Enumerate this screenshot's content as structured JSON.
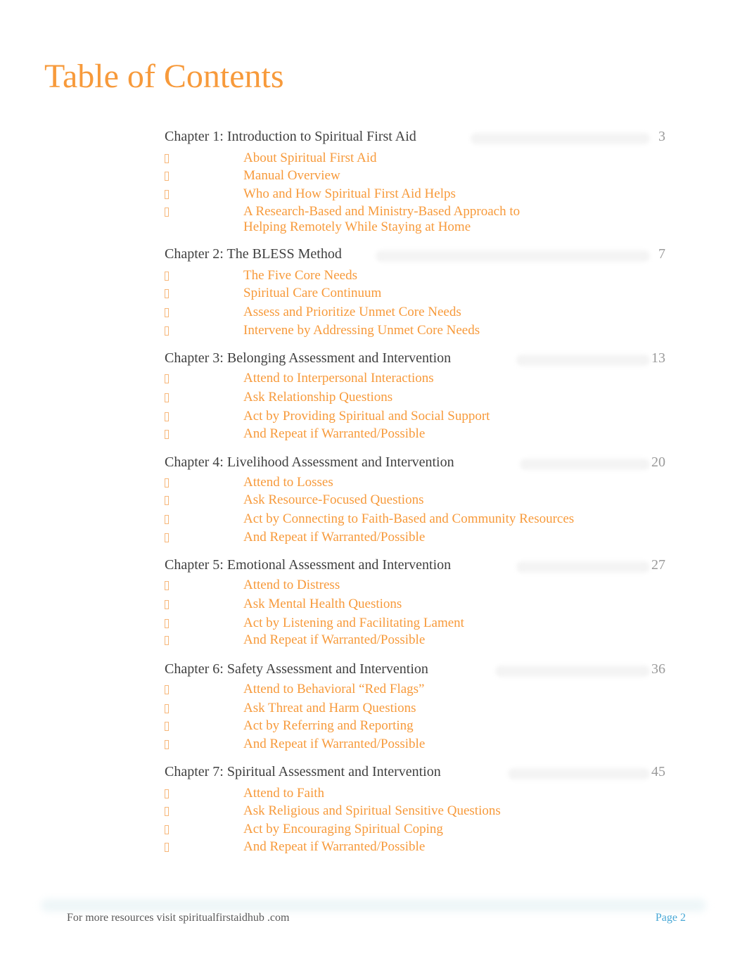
{
  "page_title": "Table of Contents",
  "chapters": [
    {
      "title": "Chapter 1: Introduction to Spiritual First Aid",
      "page": "3",
      "sections": [
        "About Spiritual First Aid",
        "Manual Overview",
        "Who and How Spiritual First Aid Helps",
        "A Research-Based and Ministry-Based Approach to Helping Remotely While Staying at Home"
      ]
    },
    {
      "title": "Chapter 2: The BLESS Method",
      "page": "7",
      "sections": [
        "The Five Core Needs",
        "Spiritual Care Continuum",
        "Assess and Prioritize Unmet Core Needs",
        "Intervene by Addressing Unmet Core Needs"
      ]
    },
    {
      "title": "Chapter 3: Belonging Assessment and Intervention",
      "page": "13",
      "sections": [
        "Attend to Interpersonal Interactions",
        "Ask Relationship Questions",
        "Act by Providing Spiritual and Social Support",
        "And Repeat if Warranted/Possible"
      ]
    },
    {
      "title": "Chapter 4: Livelihood Assessment and Intervention",
      "page": "20",
      "sections": [
        "Attend to Losses",
        "Ask Resource-Focused Questions",
        "Act by Connecting to Faith-Based and Community Resources",
        "And Repeat if Warranted/Possible"
      ]
    },
    {
      "title": "Chapter 5: Emotional Assessment and Intervention",
      "page": "27",
      "sections": [
        "Attend to Distress",
        "Ask Mental Health Questions",
        "Act by Listening and Facilitating Lament",
        "And Repeat if Warranted/Possible"
      ]
    },
    {
      "title": "Chapter 6: Safety Assessment and Intervention",
      "page": "36",
      "sections": [
        "Attend to Behavioral “Red Flags”",
        "Ask Threat and Harm Questions",
        "Act by Referring and Reporting",
        "And Repeat if Warranted/Possible"
      ]
    },
    {
      "title": "Chapter 7: Spiritual Assessment and Intervention",
      "page": "45",
      "sections": [
        "Attend to Faith",
        "Ask Religious and Spiritual Sensitive Questions",
        "Act by Encouraging Spiritual Coping",
        "And Repeat if Warranted/Possible"
      ]
    }
  ],
  "bullet_icon": "missing-glyph-box",
  "footer": {
    "text": "For more resources visit spiritualfirstaidhub  .com",
    "page_label": "Page 2"
  },
  "colors": {
    "accent": "#f79a3b",
    "chapter_text": "#404040",
    "page_number": "#9a9a9a",
    "footer_page": "#49a8d6"
  }
}
